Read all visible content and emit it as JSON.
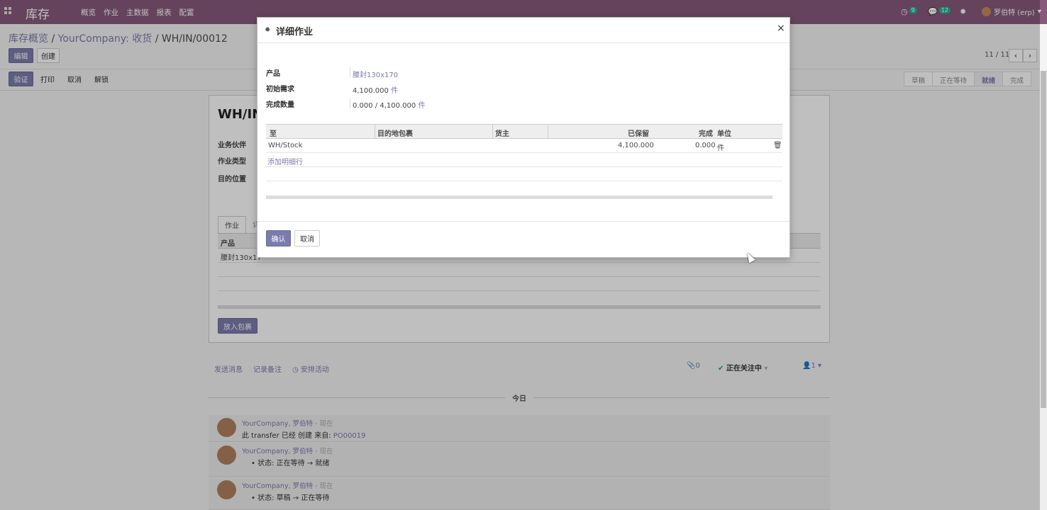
{
  "navbar": {
    "brand": "库存",
    "menu": [
      "概览",
      "作业",
      "主数据",
      "报表",
      "配置"
    ],
    "activity_count": "9",
    "message_count": "12",
    "user_name": "罗伯特 (erp)",
    "color": "#875a7b"
  },
  "breadcrumb": {
    "parent1": "库存概览",
    "sep": " / ",
    "parent2": "YourCompany: 收货",
    "current": "WH/IN/00012"
  },
  "toolbar": {
    "edit": "编辑",
    "create": "创建",
    "validate": "验证",
    "print": "打印",
    "cancel": "取消",
    "unlock": "解锁"
  },
  "pager": {
    "value": "11 / 11",
    "prev": "‹",
    "next": "›"
  },
  "statusbar": [
    "草稿",
    "正在等待",
    "就绪",
    "完成"
  ],
  "status_active": "就绪",
  "sheet": {
    "title": "WH/IN",
    "labels": [
      "业务伙伴",
      "作业类型",
      "目的位置"
    ],
    "tabs": [
      "作业",
      "详"
    ],
    "table_header": "产品",
    "row_product": "腰封130x17",
    "pack_button": "放入包裹"
  },
  "chatter": {
    "send_message": "发送消息",
    "log_note": "记录备注",
    "schedule": "安排活动",
    "attachments": "0",
    "following": "正在关注中",
    "followers": "1",
    "today": "今日",
    "messages": [
      {
        "author": "YourCompany, 罗伯特",
        "time": " - 现在",
        "body": "此 transfer 已经 创建 来自:",
        "link": "PO00019"
      },
      {
        "author": "YourCompany, 罗伯特",
        "time": " - 现在",
        "body": "状态: 正在等待 → 就绪"
      },
      {
        "author": "YourCompany, 罗伯特",
        "time": " - 现在",
        "body": "状态: 草稿 → 正在等待"
      }
    ]
  },
  "modal": {
    "title": "详细作业",
    "close": "×",
    "fields": {
      "product_label": "产品",
      "product_value": "腰封130x170",
      "initial_demand_label": "初始需求",
      "initial_demand_value": "4,100.000",
      "initial_demand_uom": "件",
      "done_qty_label": "完成数量",
      "done_qty_value": "0.000 / 4,100.000",
      "done_qty_uom": "件"
    },
    "table": {
      "columns": [
        "至",
        "目的地包裹",
        "货主",
        "已保留",
        "完成",
        "单位"
      ],
      "rows": [
        {
          "to": "WH/Stock",
          "package": "",
          "owner": "",
          "reserved": "4,100.000",
          "done": "0.000",
          "uom": "件"
        }
      ],
      "add_line": "添加明细行"
    },
    "confirm": "确认",
    "cancel": "取消"
  },
  "colors": {
    "primary": "#7c7bad",
    "brand": "#875a7b",
    "badge": "#21b799"
  }
}
